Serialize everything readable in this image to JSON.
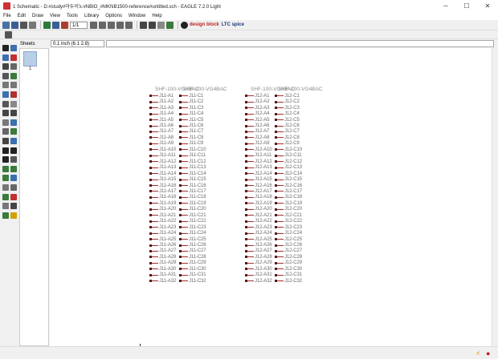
{
  "window": {
    "title": "1 Schematic - D:#study#아두이노#NBIO_#MKNB1500-reference#untitled.sch - EAGLE 7.2.0 Light",
    "controls": [
      "─",
      "☐",
      "✕"
    ]
  },
  "menu": [
    "File",
    "Edit",
    "Draw",
    "View",
    "Tools",
    "Library",
    "Options",
    "Window",
    "Help"
  ],
  "toolbar": {
    "sheet_select": "1/1",
    "brand_left": "design block",
    "brand_right": "LTC spice"
  },
  "command_bar": {
    "sheets_label": "Sheets",
    "coordinate": "0.1 inch (6.1 2.8)",
    "command_value": ""
  },
  "sheets": [
    {
      "number": "1"
    }
  ],
  "components": [
    {
      "name_a": "SHF-100-VG4BAC",
      "name_b": "SHF-100-VG4BAC",
      "prefix": "J11",
      "pin_count": 32
    },
    {
      "name_a": "SHF-100-VG4BAC",
      "name_b": "SHF-100-VG4BAC",
      "prefix": "J12",
      "pin_count": 32
    }
  ],
  "colors": {
    "pin": "#a03030",
    "pin_label": "#6a6a6a",
    "part_name": "#8a8a8a"
  },
  "status_icons": [
    "lightning-icon",
    "stop-icon"
  ]
}
